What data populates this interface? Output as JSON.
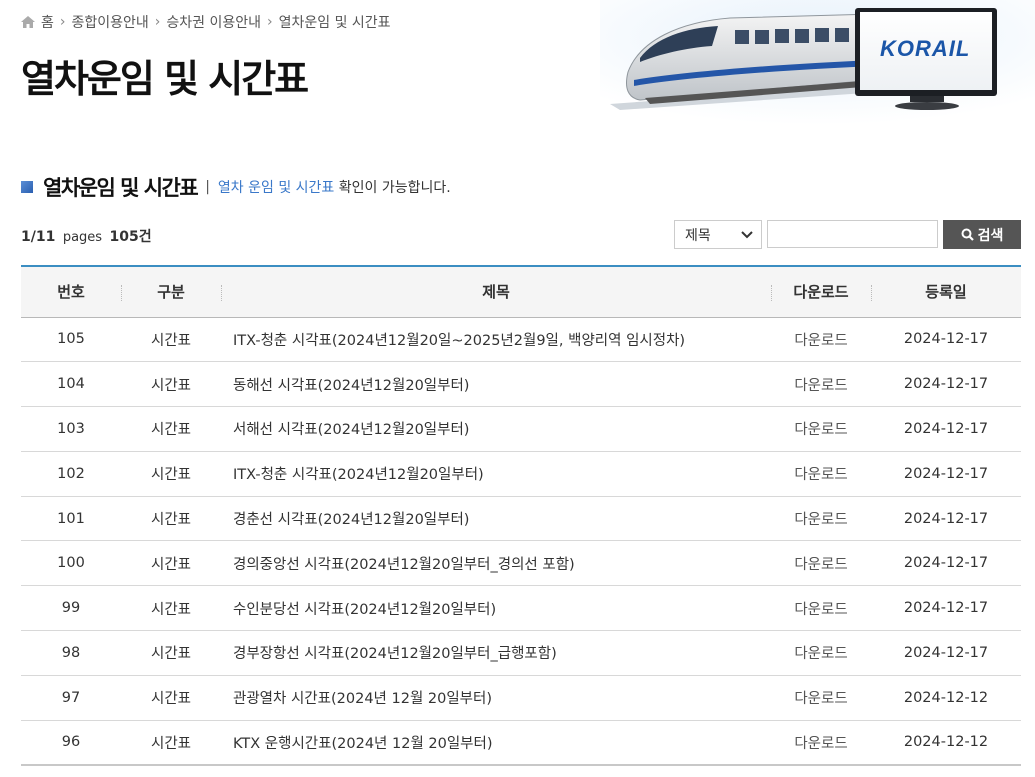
{
  "breadcrumb": {
    "items": [
      "홈",
      "종합이용안내",
      "승차권 이용안내",
      "열차운임 및 시간표"
    ]
  },
  "page_title": "열차운임 및 시간표",
  "hero": {
    "logo_text": "KORAIL"
  },
  "section": {
    "heading": "열차운임 및 시간표",
    "desc_highlight": "열차 운임 및 시간표",
    "desc_rest": " 확인이 가능합니다."
  },
  "count": {
    "current_page": "1",
    "total_pages": "/11",
    "pages_label": "pages",
    "total": "105건"
  },
  "search": {
    "select_value": "제목",
    "input_value": "",
    "button_label": "검색"
  },
  "table": {
    "headers": [
      "번호",
      "구분",
      "제목",
      "다운로드",
      "등록일"
    ],
    "rows": [
      {
        "no": "105",
        "type": "시간표",
        "title": "ITX-청춘 시각표(2024년12월20일~2025년2월9일, 백양리역 임시정차)",
        "download": "다운로드",
        "date": "2024-12-17"
      },
      {
        "no": "104",
        "type": "시간표",
        "title": "동해선 시각표(2024년12월20일부터)",
        "download": "다운로드",
        "date": "2024-12-17"
      },
      {
        "no": "103",
        "type": "시간표",
        "title": "서해선 시각표(2024년12월20일부터)",
        "download": "다운로드",
        "date": "2024-12-17"
      },
      {
        "no": "102",
        "type": "시간표",
        "title": "ITX-청춘 시각표(2024년12월20일부터)",
        "download": "다운로드",
        "date": "2024-12-17"
      },
      {
        "no": "101",
        "type": "시간표",
        "title": "경춘선 시각표(2024년12월20일부터)",
        "download": "다운로드",
        "date": "2024-12-17"
      },
      {
        "no": "100",
        "type": "시간표",
        "title": "경의중앙선 시각표(2024년12월20일부터_경의선 포함)",
        "download": "다운로드",
        "date": "2024-12-17"
      },
      {
        "no": "99",
        "type": "시간표",
        "title": "수인분당선 시각표(2024년12월20일부터)",
        "download": "다운로드",
        "date": "2024-12-17"
      },
      {
        "no": "98",
        "type": "시간표",
        "title": "경부장항선 시각표(2024년12월20일부터_급행포함)",
        "download": "다운로드",
        "date": "2024-12-17"
      },
      {
        "no": "97",
        "type": "시간표",
        "title": "관광열차 시간표(2024년 12월 20일부터)",
        "download": "다운로드",
        "date": "2024-12-12"
      },
      {
        "no": "96",
        "type": "시간표",
        "title": "KTX 운행시간표(2024년 12월 20일부터)",
        "download": "다운로드",
        "date": "2024-12-12"
      }
    ]
  },
  "colors": {
    "accent": "#3b8ec2",
    "link": "#3a78c9",
    "button": "#555555"
  }
}
